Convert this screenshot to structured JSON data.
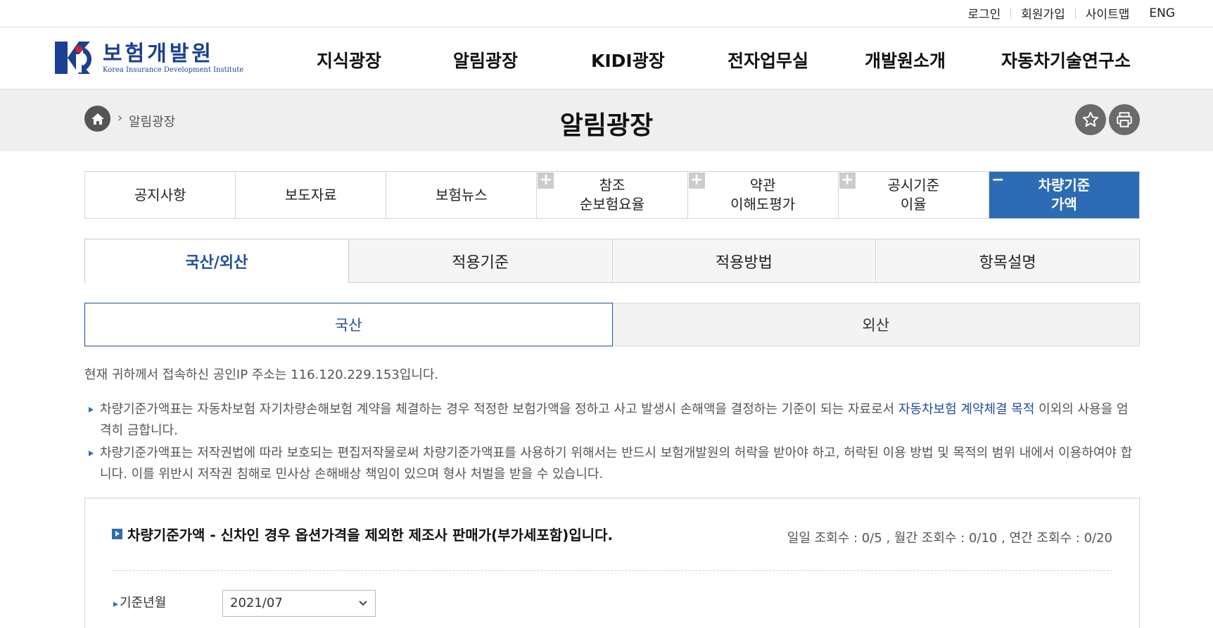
{
  "util": {
    "login": "로그인",
    "signup": "회원가입",
    "sitemap": "사이트맵",
    "eng": "ENG"
  },
  "logo": {
    "ko": "보험개발원",
    "en": "Korea Insurance Development Institute"
  },
  "gnb": [
    "지식광장",
    "알림광장",
    "KIDI광장",
    "전자업무실",
    "개발원소개",
    "자동차기술연구소"
  ],
  "breadcrumb": {
    "current": "알림광장"
  },
  "page_title": "알림광장",
  "categories": [
    {
      "line1": "공지사항",
      "line2": ""
    },
    {
      "line1": "보도자료",
      "line2": ""
    },
    {
      "line1": "보험뉴스",
      "line2": ""
    },
    {
      "line1": "참조",
      "line2": "순보험요율"
    },
    {
      "line1": "약관",
      "line2": "이해도평가"
    },
    {
      "line1": "공시기준",
      "line2": "이율"
    },
    {
      "line1": "차량기준",
      "line2": "가액"
    }
  ],
  "subtabs": [
    "국산/외산",
    "적용기준",
    "적용방법",
    "항목설명"
  ],
  "origin_tabs": [
    "국산",
    "외산"
  ],
  "ip_notice": "현재 귀하께서 접속하신 공인IP 주소는 116.120.229.153입니다.",
  "notes": {
    "n1_a": "차량기준가액표는 자동차보험 자기차량손해보험 계약을 체결하는 경우 적정한 보험가액을 정하고 사고 발생시 손해액을 결정하는 기준이 되는 자료로서 ",
    "n1_hl": "자동차보험 계약체결 목적",
    "n1_b": " 이외의 사용을 엄격히 금합니다.",
    "n2": "차량기준가액표는 저작권법에 따라 보호되는 편집저작물로써 차량기준가액표를 사용하기 위해서는 반드시 보험개발원의 허락을 받아야 하고, 허락된 이용 방법 및 목적의 범위 내에서 이용하여야 합니다. 이를 위반시 저작권 침해로 민사상 손해배상 책임이 있으며 형사 처벌을 받을 수 있습니다."
  },
  "box": {
    "title": "차량기준가액 - 신차인 경우 옵션가격을 제외한 제조사 판매가(부가세포함)입니다.",
    "views": "일일 조회수 : 0/5 , 월간 조회수 : 0/10 , 연간 조회수 : 0/20",
    "ym_label": "기준년월",
    "ym_value": "2021/07"
  },
  "colors": {
    "accent": "#2d6cb5",
    "link": "#1f4e9c"
  }
}
